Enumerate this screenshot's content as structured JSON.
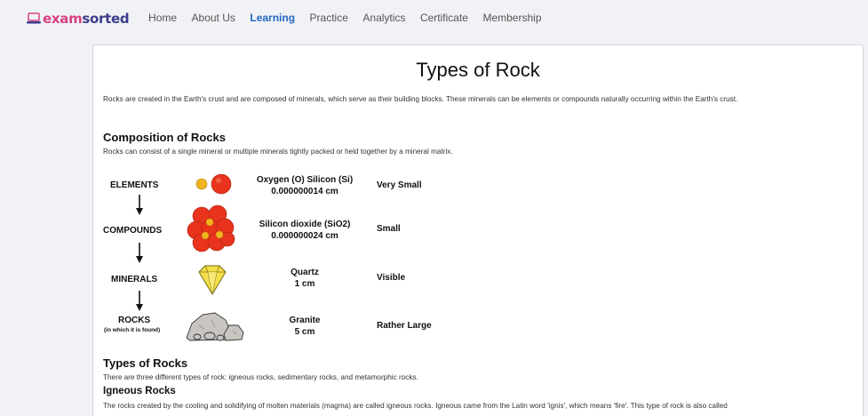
{
  "brand": {
    "part1": "exam",
    "part2": "sorted"
  },
  "nav": {
    "items": [
      {
        "label": "Home",
        "active": false
      },
      {
        "label": "About Us",
        "active": false
      },
      {
        "label": "Learning",
        "active": true
      },
      {
        "label": "Practice",
        "active": false
      },
      {
        "label": "Analytics",
        "active": false
      },
      {
        "label": "Certificate",
        "active": false
      },
      {
        "label": "Membership",
        "active": false
      }
    ]
  },
  "article": {
    "title": "Types of Rock",
    "intro": "Rocks are created in the Earth's crust and are composed of minerals, which serve as their building blocks. These minerals can be elements or compounds naturally occurring within the Earth's crust.",
    "composition_heading": "Composition of Rocks",
    "composition_text": "Rocks can consist of a single mineral or multiple minerals tightly packed or held together by a mineral matrix.",
    "types_heading": "Types of Rocks",
    "types_text": "There are three different types of rock: igneous rocks, sedimentary rocks, and metamorphic rocks.",
    "igneous_heading": "Igneous Rocks",
    "igneous_text": "The rocks created by the cooling and solidifying of molten materials (magma) are called igneous rocks. Igneous came from the Latin word 'ignis', which means 'fire'. This type of rock is also called"
  },
  "figure": {
    "rows": [
      {
        "level": "ELEMENTS",
        "note": "",
        "example_line1": "Oxygen (O) Silicon (Si)",
        "example_line2": "0.000000014 cm",
        "size": "Very Small",
        "icon": "atoms-icon"
      },
      {
        "level": "COMPOUNDS",
        "note": "",
        "example_line1": "Silicon dioxide (SiO2)",
        "example_line2": "0.000000024 cm",
        "size": "Small",
        "icon": "molecule-icon"
      },
      {
        "level": "MINERALS",
        "note": "",
        "example_line1": "Quartz",
        "example_line2": "1 cm",
        "size": "Visible",
        "icon": "crystal-icon"
      },
      {
        "level": "ROCKS",
        "note": "(in which it is found)",
        "example_line1": "Granite",
        "example_line2": "5 cm",
        "size": "Rather Large",
        "icon": "rocks-icon"
      }
    ],
    "colors": {
      "atom": "#e8341c",
      "atom_small": "#f0b41f",
      "crystal": "#f4e04a",
      "rock": "#c9c6c2"
    }
  }
}
